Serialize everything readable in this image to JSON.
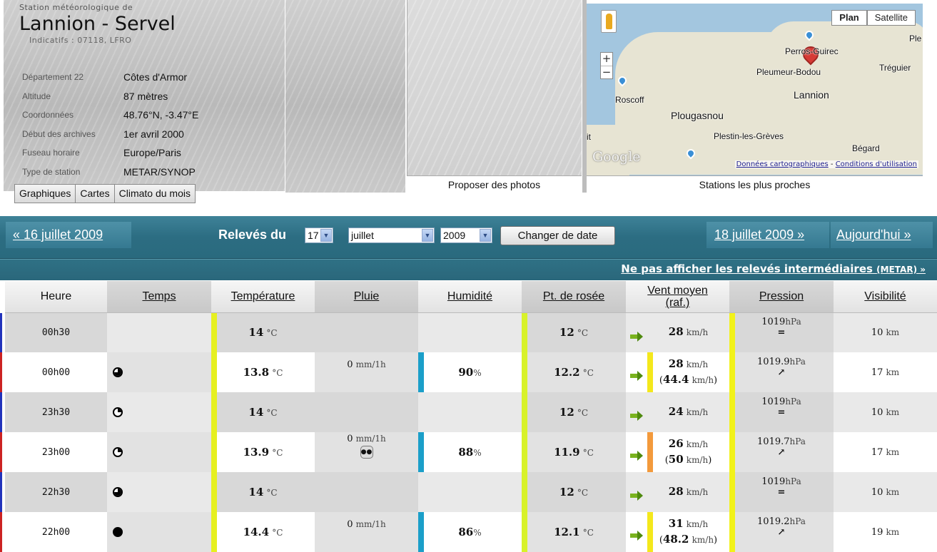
{
  "station": {
    "subtitle": "Station météorologique de",
    "name": "Lannion - Servel",
    "codes": "Indicatifs : 07118, LFRO",
    "info": [
      {
        "key": "Département 22",
        "value": "Côtes d'Armor"
      },
      {
        "key": "Altitude",
        "value": "87 mètres"
      },
      {
        "key": "Coordonnées",
        "value": "48.76°N, -3.47°E"
      },
      {
        "key": "Début des archives",
        "value": "1er avril 2000"
      },
      {
        "key": "Fuseau horaire",
        "value": "Europe/Paris"
      },
      {
        "key": "Type de station",
        "value": "METAR/SYNOP"
      }
    ],
    "tabs": [
      "Graphiques",
      "Cartes",
      "Climato du mois"
    ]
  },
  "photos": {
    "caption": "Proposer des photos"
  },
  "map": {
    "caption": "Stations les plus proches",
    "type_buttons": [
      "Plan",
      "Satellite"
    ],
    "zoom_in": "+",
    "zoom_out": "−",
    "logo": "Google",
    "links": [
      "Données cartographiques",
      "Conditions d'utilisation"
    ],
    "towns": [
      "Perros-Guirec",
      "Pleumeur-Bodou",
      "Tréguier",
      "Lannion",
      "Roscoff",
      "Plougasnou",
      "Plestin-les-Grèves",
      "Bégard",
      "Ple",
      "it"
    ]
  },
  "nav": {
    "prev": "« 16 juillet 2009",
    "releves_label": "Relevés du",
    "day": "17",
    "month": "juillet",
    "year": "2009",
    "change_button": "Changer de date",
    "next": "18 juillet 2009 »",
    "today": "Aujourd'hui »",
    "toggle_intermediate": "Ne pas afficher les relevés intermédiaires",
    "toggle_intermediate_tag": "(METAR) »"
  },
  "table": {
    "headers": {
      "hour": "Heure",
      "weather": "Temps",
      "temperature": "Température",
      "rain": "Pluie",
      "humidity": "Humidité",
      "dewpoint": "Pt. de rosée",
      "wind_1": "Vent moyen",
      "wind_2": "(raf.)",
      "pressure": "Pression",
      "visibility": "Visibilité"
    },
    "units": {
      "temp": "°C",
      "rain": "mm/1h",
      "hum": "%",
      "wind": "km/h",
      "press": "hPa",
      "vis": "km"
    },
    "rows": [
      {
        "type": "metar",
        "hour": "00h30",
        "weather": "",
        "temp": "14",
        "rain": "",
        "hum": "",
        "dew": "12",
        "wind": "28",
        "gust": "",
        "press": "1019",
        "trend": "=",
        "vis": "10"
      },
      {
        "type": "synop",
        "hour": "00h00",
        "weather": "three-quarter",
        "temp": "13.8",
        "rain": "0",
        "hum": "90",
        "dew": "12.2",
        "wind": "28",
        "gust": "44.4",
        "press": "1019.9",
        "trend": "↗",
        "vis": "17"
      },
      {
        "type": "metar",
        "hour": "23h30",
        "weather": "quarter",
        "temp": "14",
        "rain": "",
        "hum": "",
        "dew": "12",
        "wind": "24",
        "gust": "",
        "press": "1019",
        "trend": "=",
        "vis": "10"
      },
      {
        "type": "synop",
        "hour": "23h00",
        "weather": "quarter",
        "temp": "13.9",
        "rain": "0",
        "hum": "88",
        "dew": "11.9",
        "wind": "26",
        "gust": "50",
        "press": "1019.7",
        "trend": "↗",
        "vis": "17"
      },
      {
        "type": "metar",
        "hour": "22h30",
        "weather": "three-quarter",
        "temp": "14",
        "rain": "",
        "hum": "",
        "dew": "12",
        "wind": "28",
        "gust": "",
        "press": "1019",
        "trend": "=",
        "vis": "10"
      },
      {
        "type": "synop",
        "hour": "22h00",
        "weather": "full",
        "temp": "14.4",
        "rain": "0",
        "hum": "86",
        "dew": "12.1",
        "wind": "31",
        "gust": "48.2",
        "press": "1019.2",
        "trend": "↗",
        "vis": "19"
      }
    ]
  },
  "colors": {
    "nav_bg": "#2c6d82",
    "temp_bar": "#e6f020",
    "dew_bar": "#d8f22a",
    "hum_bar": "#1b9fc9",
    "wind_bar_low": "#f4e81c",
    "wind_bar_high": "#f39a3c",
    "press_bar": "#f2f21a",
    "metar_edge": "#2233bb",
    "synop_edge": "#cc2222"
  }
}
